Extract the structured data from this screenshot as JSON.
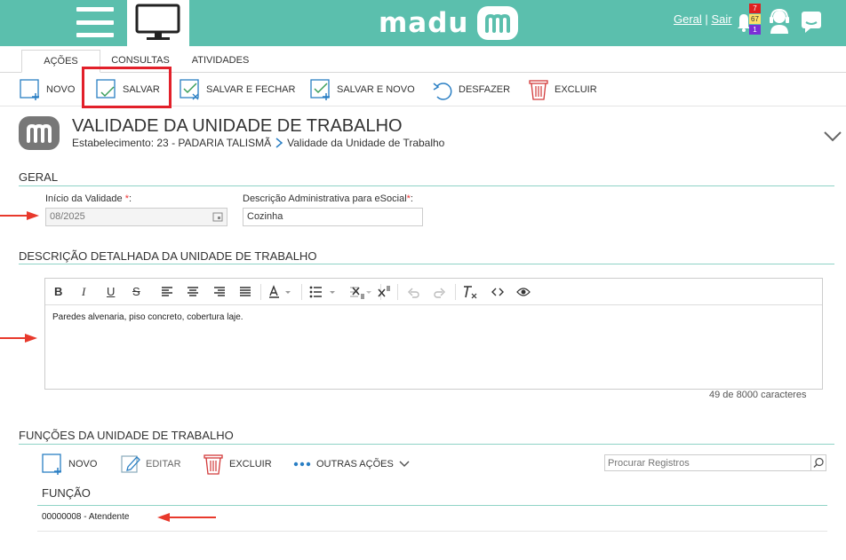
{
  "header": {
    "logo_text": "madu",
    "links": {
      "geral": "Geral",
      "separator": "|",
      "sair": "Sair"
    },
    "notification_counts": [
      "7",
      "67",
      "1"
    ]
  },
  "tabs": [
    {
      "label": "AÇÕES"
    },
    {
      "label": "CONSULTAS"
    },
    {
      "label": "ATIVIDADES"
    }
  ],
  "toolbar": {
    "novo": "NOVO",
    "salvar": "SALVAR",
    "salvar_fechar": "SALVAR E FECHAR",
    "salvar_novo": "SALVAR E NOVO",
    "desfazer": "DESFAZER",
    "excluir": "EXCLUIR"
  },
  "page": {
    "title": "VALIDADE DA UNIDADE DE TRABALHO",
    "breadcrumb_1": "Estabelecimento: 23 - PADARIA TALISMÃ",
    "breadcrumb_2": "Validade da Unidade de Trabalho"
  },
  "geral": {
    "section_title": "GERAL",
    "inicio_label": "Início da Validade",
    "inicio_req": "*",
    "inicio_colon": ":",
    "inicio_value": "08/2025",
    "descricao_label": "Descrição Administrativa para eSocial",
    "descricao_req": "*",
    "descricao_colon": ":",
    "descricao_value": "Cozinha"
  },
  "descricao_detalhada": {
    "section_title": "DESCRIÇÃO DETALHADA DA UNIDADE DE TRABALHO",
    "content": "Paredes alvenaria, piso concreto, cobertura laje.",
    "char_count": "49 de 8000 caracteres"
  },
  "funcoes": {
    "section_title": "FUNÇÕES DA UNIDADE DE TRABALHO",
    "novo": "NOVO",
    "editar": "EDITAR",
    "excluir": "EXCLUIR",
    "outras_acoes": "OUTRAS AÇÕES",
    "search_placeholder": "Procurar Registros",
    "column_header": "FUNÇÃO",
    "rows": [
      "00000008 - Atendente"
    ]
  },
  "colors": {
    "accent": "#5bbfad",
    "highlight": "#e2202a",
    "annotation_arrow": "#e8392c"
  }
}
